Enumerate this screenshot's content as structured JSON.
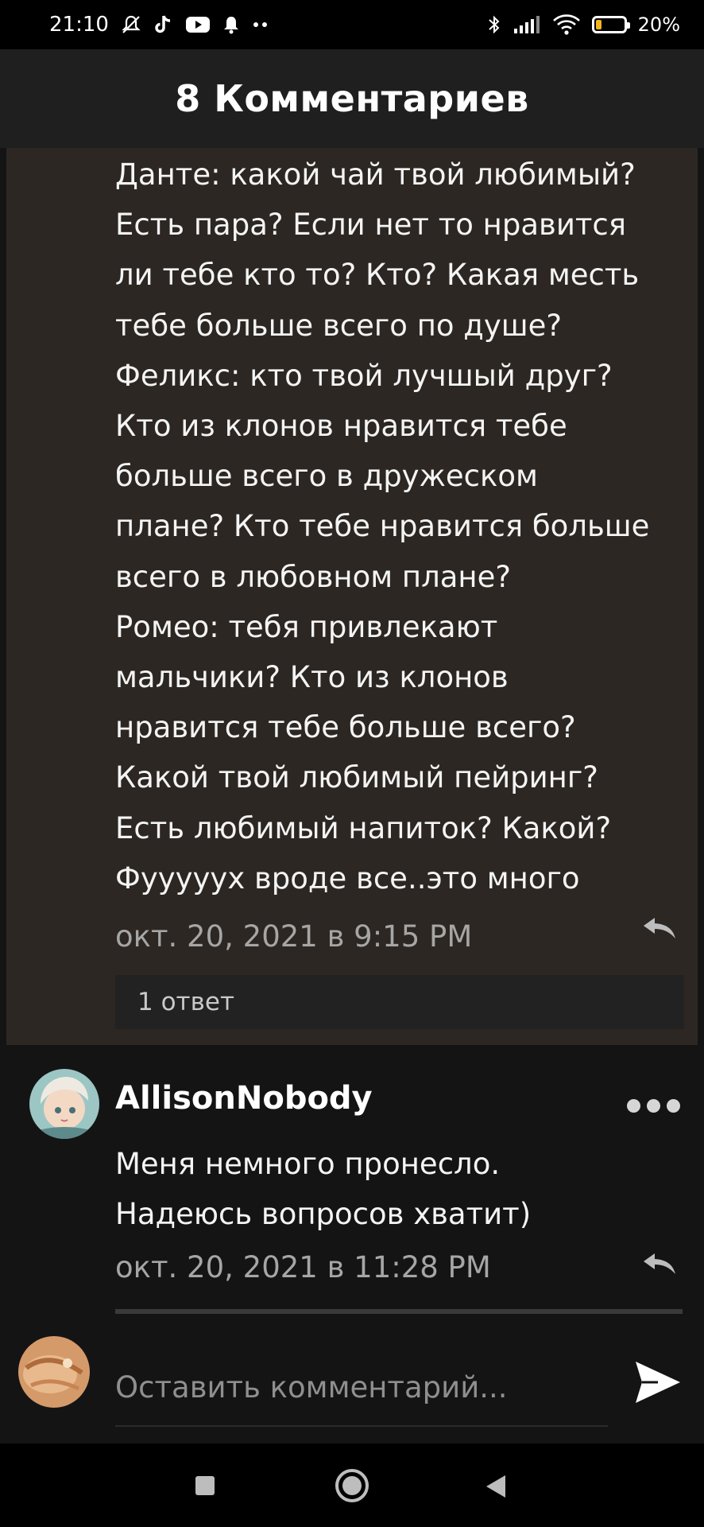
{
  "status_bar": {
    "time": "21:10",
    "left_icons": [
      "mute-icon",
      "tiktok-icon",
      "youtube-icon",
      "bell-icon",
      "more-dots-icon"
    ],
    "right_icons": [
      "bluetooth-icon",
      "signal-icon",
      "wifi-icon",
      "battery-icon"
    ],
    "battery_percent": "20%",
    "battery_level": 0.2,
    "battery_color": "#f2b51c"
  },
  "header": {
    "title": "8 Комментариев"
  },
  "highlighted_comment": {
    "lines": [
      "Данте: какой чай твой любимый?",
      "Есть пара? Если нет то нравится",
      "ли тебе кто то? Кто? Какая месть",
      "тебе больше всего по душе?",
      "Феликс: кто твой лучшый друг?",
      "Кто из клонов нравится тебе",
      "больше всего в дружеском",
      "плане? Кто тебе нравится больше",
      "всего в любовном плане?",
      "Ромео: тебя привлекают",
      "мальчики? Кто из клонов",
      "нравится тебе больше всего?",
      "Какой твой любимый пейринг?",
      "Есть любимый напиток? Какой?",
      "Фууууух вроде все..это много"
    ],
    "timestamp": "окт. 20, 2021 в 9:15 PM",
    "replies_label": "1 ответ",
    "background": "#2c2722"
  },
  "comment2": {
    "username": "AllisonNobody",
    "lines": [
      "Меня немного пронесло.",
      "Надеюсь вопросов хватит)"
    ],
    "timestamp": "окт. 20, 2021 в 11:28 PM"
  },
  "compose": {
    "placeholder": "Оставить комментарий..."
  },
  "navbar": {
    "buttons": [
      "recent-apps-icon",
      "home-icon",
      "back-icon"
    ]
  }
}
